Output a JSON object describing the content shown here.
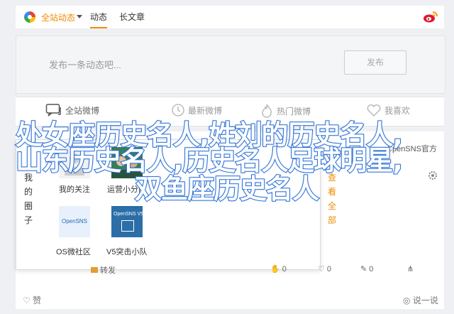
{
  "topbar": {
    "global_label": "全站动态",
    "tabs": [
      "动态",
      "长文章"
    ]
  },
  "composer": {
    "placeholder": "发布一条动态吧...",
    "publish_label": "发布"
  },
  "actions": [
    {
      "label": "全站微博",
      "icon": "chat-icon"
    },
    {
      "label": "最新微博",
      "icon": "clock-icon"
    },
    {
      "label": "热门微博",
      "icon": "fire-icon"
    },
    {
      "label": "我喜欢",
      "icon": "heart-icon"
    }
  ],
  "brand": {
    "prefix": "C",
    "rest": "penSNS官方"
  },
  "popup": {
    "left_vertical": "我的圈子",
    "right_vertical": "查看全部",
    "items": [
      {
        "label": "我的关注"
      },
      {
        "label": "运营小分队"
      },
      {
        "label": "OS微社区"
      },
      {
        "label": "V5突击小队"
      }
    ],
    "os_logo_text": "OpenSNS",
    "v5_logo_text": "OpenSNS V5"
  },
  "footer": {
    "share": "转发",
    "c1": "0",
    "c2": "0",
    "c3": "0"
  },
  "bottom": {
    "like": "赞",
    "comment": "说一说"
  },
  "overlay": {
    "line1": "处女座历史名人,姓刘的历史名人,",
    "line2": "山东历史名人,历史名人足球明星,",
    "line3": "双鱼座历史名人"
  }
}
